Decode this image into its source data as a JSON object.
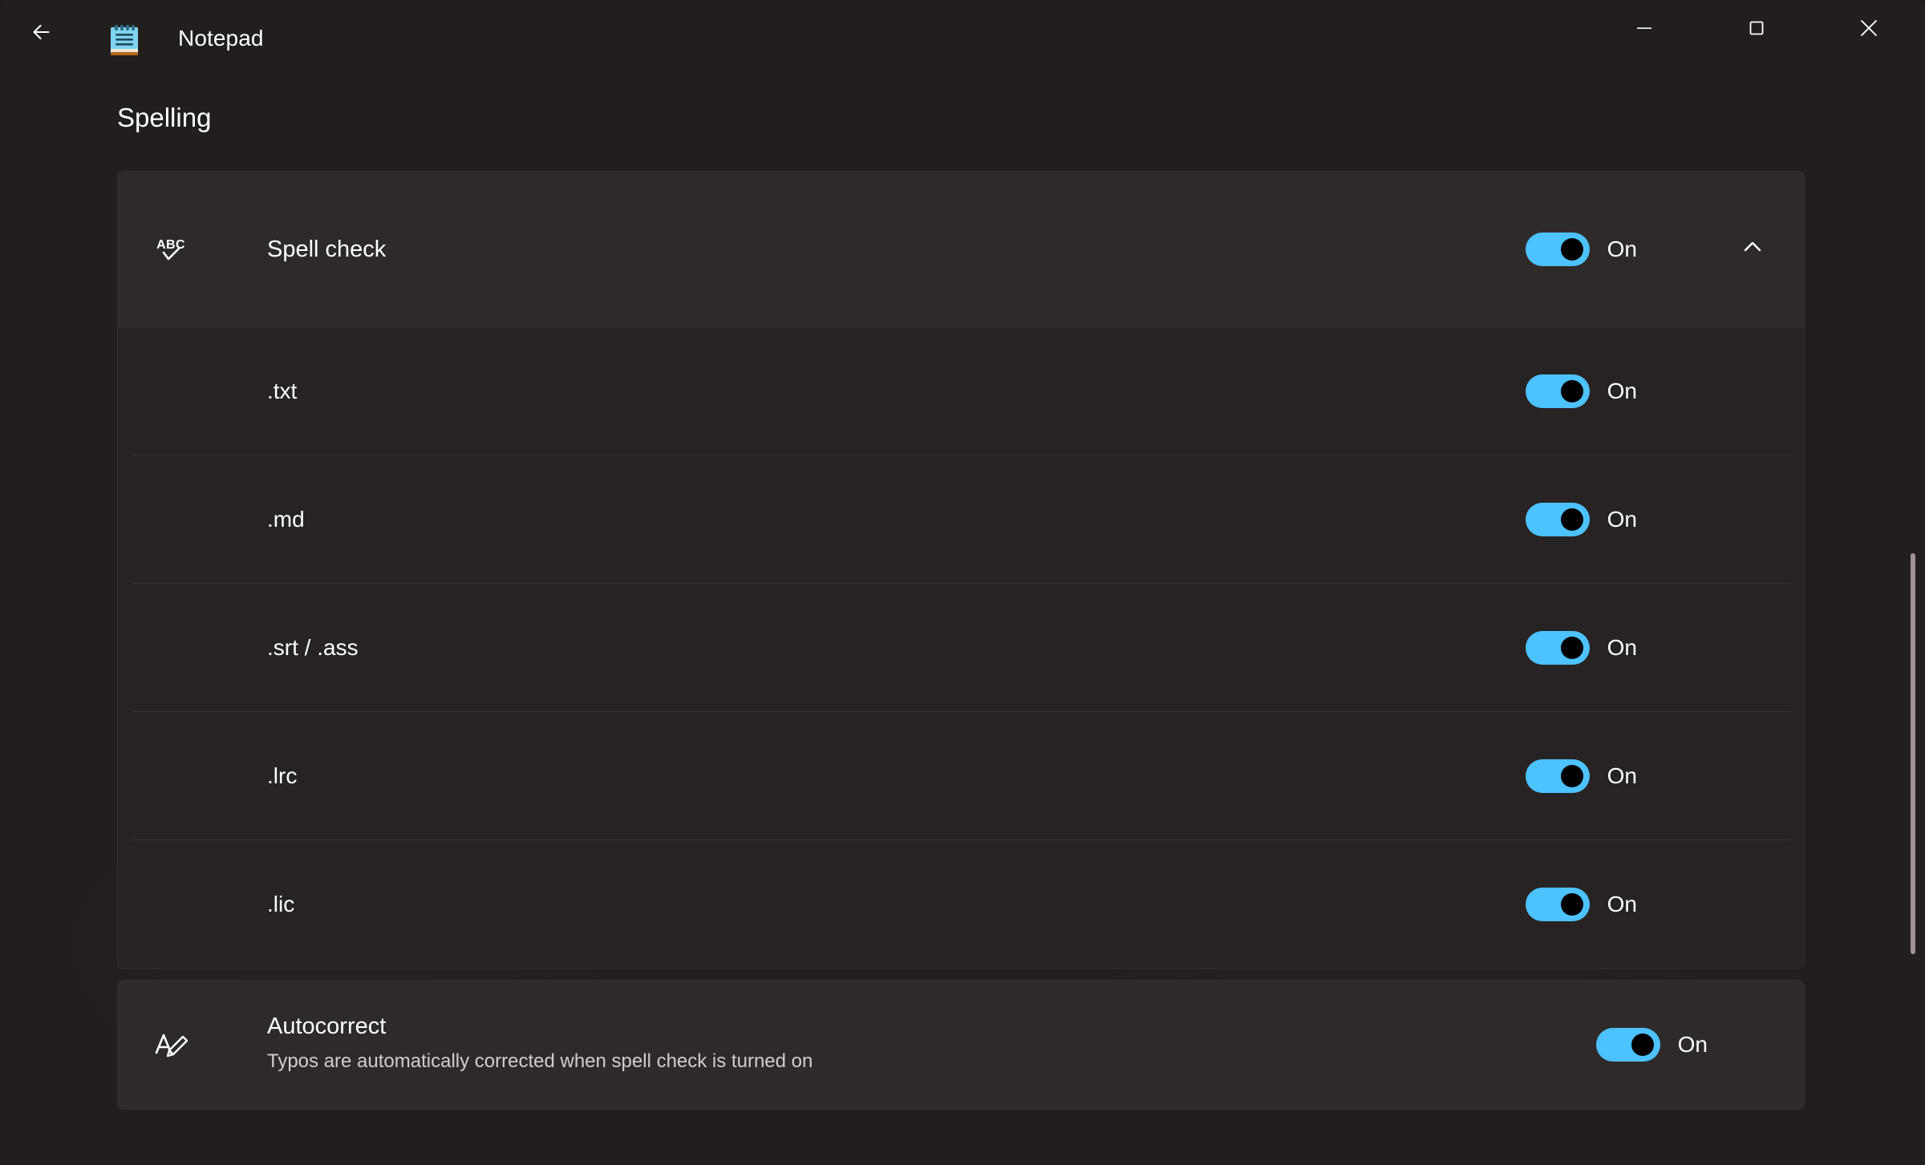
{
  "window": {
    "app_title": "Notepad",
    "app_icon": "notepad-icon",
    "back_icon": "back-arrow-icon",
    "controls": {
      "minimize": "minimize-icon",
      "maximize": "maximize-icon",
      "close": "close-icon"
    }
  },
  "page": {
    "title": "Spelling"
  },
  "spell_check": {
    "icon": "abc-spellcheck-icon",
    "label": "Spell check",
    "toggle_state": "On",
    "toggle_on": true,
    "expander_icon": "chevron-up-icon",
    "expanded": true,
    "file_types": [
      {
        "label": ".txt",
        "toggle_state": "On",
        "toggle_on": true
      },
      {
        "label": ".md",
        "toggle_state": "On",
        "toggle_on": true
      },
      {
        "label": ".srt / .ass",
        "toggle_state": "On",
        "toggle_on": true
      },
      {
        "label": ".lrc",
        "toggle_state": "On",
        "toggle_on": true
      },
      {
        "label": ".lic",
        "toggle_state": "On",
        "toggle_on": true
      }
    ]
  },
  "autocorrect": {
    "icon": "autocorrect-pen-icon",
    "title": "Autocorrect",
    "description": "Typos are automatically corrected when spell check is turned on",
    "toggle_state": "On",
    "toggle_on": true
  },
  "colors": {
    "accent": "#4cc2ff",
    "window_bg": "#231e1e",
    "card_bg": "#2f2a2a",
    "subrow_bg": "#282323",
    "text": "#ffffff",
    "text_secondary": "#d3cccc"
  },
  "scrollbar": {
    "visible": true
  }
}
